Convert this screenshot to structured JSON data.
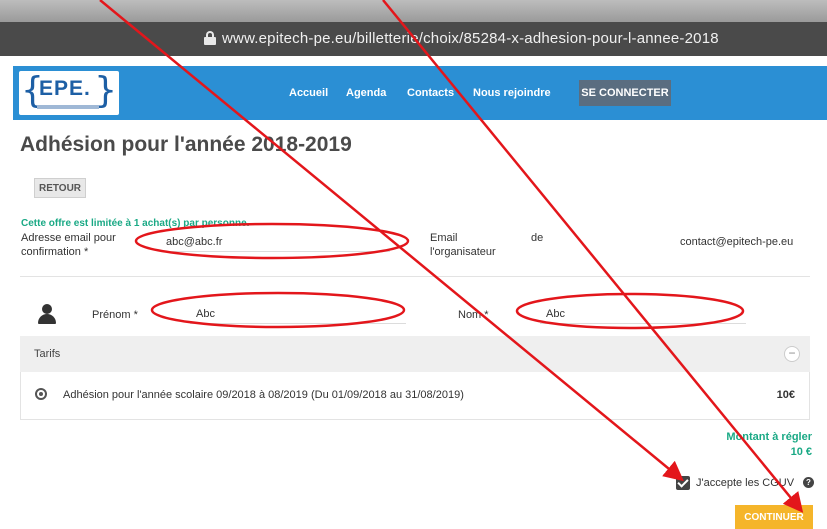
{
  "browser": {
    "url": "www.epitech-pe.eu/billetterie/choix/85284-x-adhesion-pour-l-annee-2018"
  },
  "site": {
    "logo_text": "EPE.",
    "nav": [
      "Accueil",
      "Agenda",
      "Contacts",
      "Nous rejoindre"
    ],
    "connect_label": "SE CONNECTER"
  },
  "page": {
    "title": "Adhésion pour l'année 2018-2019",
    "back_label": "RETOUR",
    "limit_note": "Cette offre est limitée à 1 achat(s) par personne.",
    "email_label_1": "Adresse email pour",
    "email_label_2": "confirmation *",
    "email_value": "abc@abc.fr",
    "organizer_label_1": "Email",
    "organizer_label_2": "l'organisateur",
    "organizer_de": "de",
    "organizer_email": "contact@epitech-pe.eu",
    "prenom_label": "Prénom *",
    "prenom_value": "Abc",
    "nom_label": "Nom *",
    "nom_value": "Abc",
    "tarifs_label": "Tarifs",
    "collapse_symbol": "−",
    "tarif_desc": "Adhésion pour l'année scolaire 09/2018 à 08/2019 (Du 01/09/2018 au 31/08/2019)",
    "tarif_price": "10€",
    "montant_label": "Montant à régler",
    "montant_value": "10 €",
    "accept_label": "J'accepte les CGUV",
    "help_symbol": "?",
    "continue_label": "CONTINUER"
  },
  "colors": {
    "nav": "#2b8fd4",
    "accent_green": "#1aa985",
    "button_orange": "#f5b52a",
    "annotation": "#e3161b"
  }
}
